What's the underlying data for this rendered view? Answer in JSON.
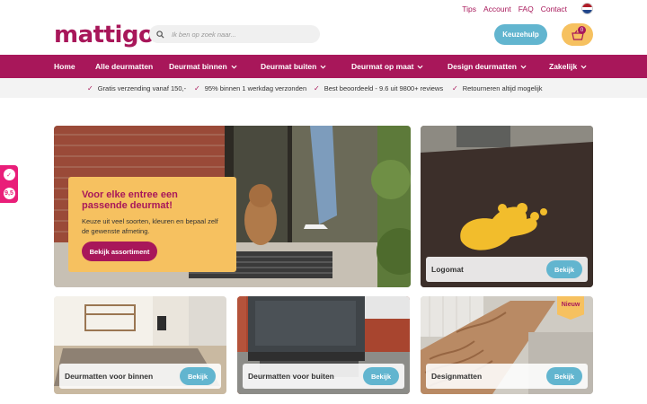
{
  "top_links": [
    "Tips",
    "Account",
    "FAQ",
    "Contact"
  ],
  "logo": "mattigo",
  "search": {
    "placeholder": "Ik ben op zoek naar..."
  },
  "keuzehulp_label": "Keuzehulp",
  "cart": {
    "count": "0"
  },
  "nav": [
    {
      "label": "Home",
      "has_dropdown": false
    },
    {
      "label": "Alle deurmatten",
      "has_dropdown": false
    },
    {
      "label": "Deurmat binnen",
      "has_dropdown": true
    },
    {
      "label": "Deurmat buiten",
      "has_dropdown": true
    },
    {
      "label": "Deurmat op maat",
      "has_dropdown": true
    },
    {
      "label": "Design deurmatten",
      "has_dropdown": true
    },
    {
      "label": "Zakelijk",
      "has_dropdown": true
    }
  ],
  "usps": [
    "Gratis verzending vanaf 150,-",
    "95% binnen 1 werkdag verzonden",
    "Best beoordeeld - 9.6 uit 9800+ reviews",
    "Retourneren altijd mogelijk"
  ],
  "side_badge": {
    "score": "9,5"
  },
  "hero": {
    "title": "Voor elke entree een passende deurmat!",
    "text": "Keuze uit veel soorten, kleuren en bepaal zelf de gewenste afmeting.",
    "button": "Bekijk assortiment"
  },
  "cards": [
    {
      "name": "Logomat",
      "button": "Bekijk"
    },
    {
      "name": "Deurmatten voor binnen",
      "button": "Bekijk"
    },
    {
      "name": "Deurmatten voor buiten",
      "button": "Bekijk"
    },
    {
      "name": "Designmatten",
      "button": "Bekijk",
      "tag": "Nieuw"
    }
  ],
  "colors": {
    "brand": "#a8175a",
    "accent_blue": "#62b5cf",
    "accent_yellow": "#f6c160"
  }
}
